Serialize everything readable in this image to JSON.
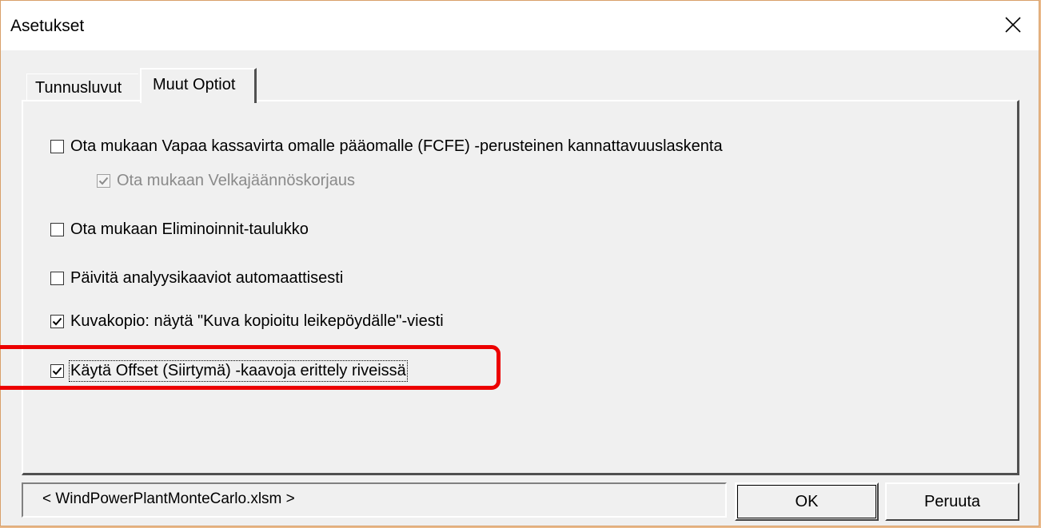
{
  "window": {
    "title": "Asetukset",
    "close_icon": "close-icon"
  },
  "tabs": [
    {
      "label": "Tunnusluvut",
      "active": false
    },
    {
      "label": "Muut Optiot",
      "active": true
    }
  ],
  "options": [
    {
      "label": "Ota mukaan Vapaa kassavirta omalle pääomalle (FCFE) -perusteinen kannattavuuslaskenta",
      "checked": false,
      "enabled": true
    },
    {
      "label": "Ota mukaan Velkajäännöskorjaus",
      "checked": true,
      "enabled": false
    },
    {
      "label": "Ota mukaan Eliminoinnit-taulukko",
      "checked": false,
      "enabled": true
    },
    {
      "label": "Päivitä analyysikaaviot automaattisesti",
      "checked": false,
      "enabled": true
    },
    {
      "label": "Kuvakopio: näytä \"Kuva kopioitu leikepöydälle\"-viesti",
      "checked": true,
      "enabled": true
    },
    {
      "label": "Käytä Offset (Siirtymä) -kaavoja erittely riveissä",
      "checked": true,
      "enabled": true,
      "focused": true
    }
  ],
  "highlight_color": "#ec0000",
  "footer": {
    "file_label": "< WindPowerPlantMonteCarlo.xlsm >",
    "ok_label": "OK",
    "cancel_label": "Peruuta"
  }
}
